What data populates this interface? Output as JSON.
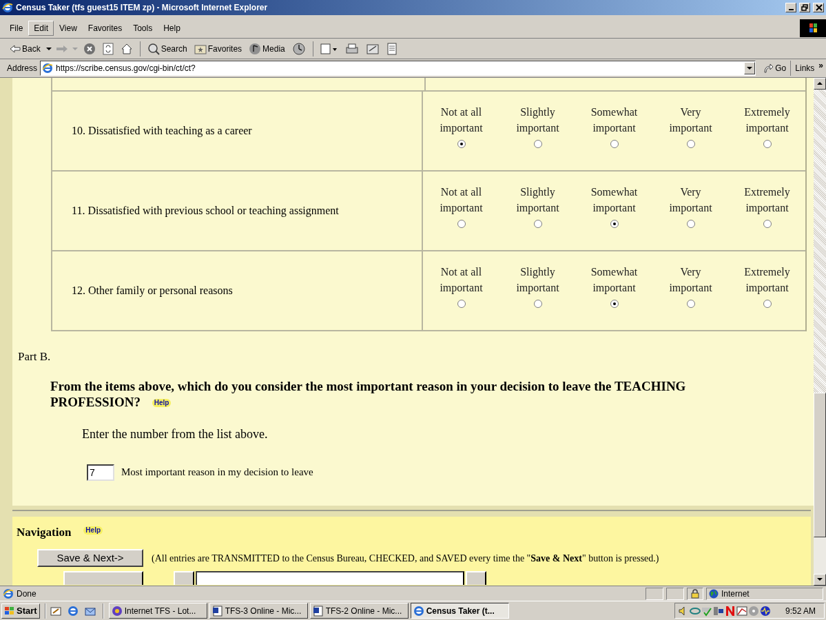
{
  "window": {
    "title": "Census Taker (tfs guest15 ITEM zp) - Microsoft Internet Explorer"
  },
  "menu": [
    {
      "label": "File",
      "selected": false
    },
    {
      "label": "Edit",
      "selected": true
    },
    {
      "label": "View",
      "selected": false
    },
    {
      "label": "Favorites",
      "selected": false
    },
    {
      "label": "Tools",
      "selected": false
    },
    {
      "label": "Help",
      "selected": false
    }
  ],
  "toolbar": {
    "back": "Back",
    "search": "Search",
    "favorites": "Favorites",
    "media": "Media"
  },
  "address": {
    "label": "Address",
    "url": "https://scribe.census.gov/cgi-bin/ct/ct?",
    "go": "Go",
    "links": "Links",
    "more": "»"
  },
  "questions": [
    {
      "label": "10. Dissatisfied with teaching as a career",
      "options": [
        {
          "label": "Not at all important",
          "selected": true
        },
        {
          "label": "Slightly important",
          "selected": false
        },
        {
          "label": "Somewhat important",
          "selected": false
        },
        {
          "label": "Very important",
          "selected": false
        },
        {
          "label": "Extremely important",
          "selected": false
        }
      ]
    },
    {
      "label": "11. Dissatisfied with previous school or teaching assignment",
      "options": [
        {
          "label": "Not at all important",
          "selected": false
        },
        {
          "label": "Slightly important",
          "selected": false
        },
        {
          "label": "Somewhat important",
          "selected": true
        },
        {
          "label": "Very important",
          "selected": false
        },
        {
          "label": "Extremely important",
          "selected": false
        }
      ]
    },
    {
      "label": "12. Other family or personal reasons",
      "options": [
        {
          "label": "Not at all important",
          "selected": false
        },
        {
          "label": "Slightly important",
          "selected": false
        },
        {
          "label": "Somewhat important",
          "selected": true
        },
        {
          "label": "Very important",
          "selected": false
        },
        {
          "label": "Extremely important",
          "selected": false
        }
      ]
    }
  ],
  "part_b": {
    "heading": "Part B.",
    "question": "From the items above, which do you consider the most important reason in your decision to leave the TEACHING PROFESSION?",
    "help": "Help",
    "instruction": "Enter the number from the list above.",
    "answer": "7",
    "answer_label": "Most important reason in my decision to leave"
  },
  "navigation": {
    "title": "Navigation",
    "help": "Help",
    "save_button": "Save & Next->",
    "note": "(All entries are TRANSMITTED to the Census Bureau, CHECKED, and SAVED every time the \"**Save & Next**\" button is pressed.)"
  },
  "status_bar": {
    "text": "Done",
    "zone": "Internet"
  },
  "taskbar": {
    "start": "Start",
    "tasks": [
      {
        "label": "Internet TFS  - Lot...",
        "selected": false
      },
      {
        "label": "TFS-3 Online - Mic...",
        "selected": false
      },
      {
        "label": "TFS-2 Online - Mic...",
        "selected": false
      },
      {
        "label": "Census Taker (t...",
        "selected": true
      }
    ],
    "clock": "9:52 AM"
  }
}
